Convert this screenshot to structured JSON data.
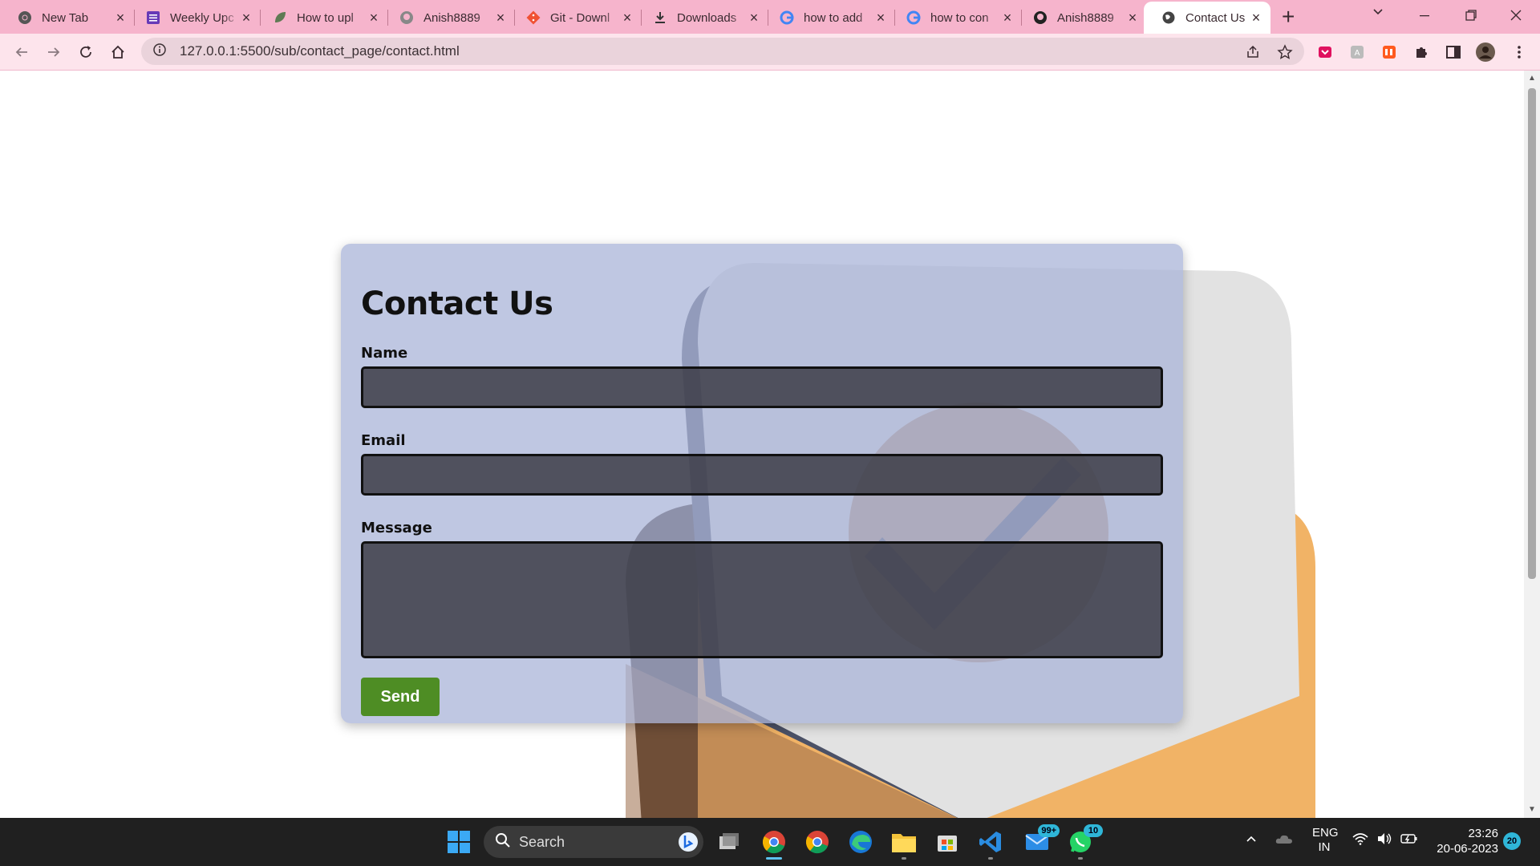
{
  "browser": {
    "tabs": [
      {
        "title": "New Tab",
        "icon": "chrome-icon"
      },
      {
        "title": "Weekly Upc",
        "icon": "form-icon"
      },
      {
        "title": "How to upl",
        "icon": "leaf-icon"
      },
      {
        "title": "Anish8889",
        "icon": "github-icon"
      },
      {
        "title": "Git - Downl",
        "icon": "git-icon"
      },
      {
        "title": "Downloads",
        "icon": "download-icon"
      },
      {
        "title": "how to add",
        "icon": "google-icon"
      },
      {
        "title": "how to con",
        "icon": "google-icon"
      },
      {
        "title": "Anish8889",
        "icon": "github-icon"
      },
      {
        "title": "Contact Us",
        "icon": "globe-icon"
      }
    ],
    "url": "127.0.0.1:5500/sub/contact_page/contact.html",
    "colors": {
      "tabbar": "#f6b4cc",
      "accent": "#4e8d24"
    }
  },
  "page": {
    "title": "Contact Us",
    "fields": {
      "name_label": "Name",
      "email_label": "Email",
      "message_label": "Message"
    },
    "send_label": "Send"
  },
  "taskbar": {
    "search_label": "Search",
    "mail_badge": "99+",
    "whatsapp_badge": "10",
    "lang": "ENG",
    "region": "IN",
    "time": "23:26",
    "date": "20-06-2023",
    "notification_count": "20"
  }
}
